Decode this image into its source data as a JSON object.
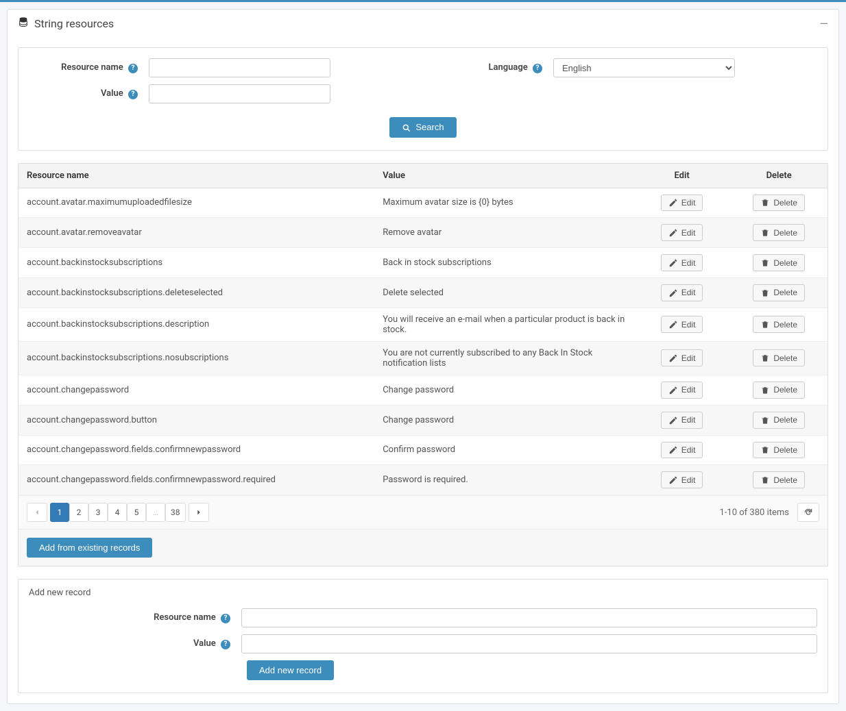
{
  "header": {
    "title": "String resources"
  },
  "search": {
    "resource_name_label": "Resource name",
    "value_label": "Value",
    "language_label": "Language",
    "language_selected": "English",
    "search_button": "Search"
  },
  "table": {
    "columns": {
      "resource_name": "Resource name",
      "value": "Value",
      "edit": "Edit",
      "delete": "Delete"
    },
    "edit_label": "Edit",
    "delete_label": "Delete",
    "rows": [
      {
        "name": "account.avatar.maximumuploadedfilesize",
        "value": "Maximum avatar size is {0} bytes"
      },
      {
        "name": "account.avatar.removeavatar",
        "value": "Remove avatar"
      },
      {
        "name": "account.backinstocksubscriptions",
        "value": "Back in stock subscriptions"
      },
      {
        "name": "account.backinstocksubscriptions.deleteselected",
        "value": "Delete selected"
      },
      {
        "name": "account.backinstocksubscriptions.description",
        "value": "You will receive an e-mail when a particular product is back in stock."
      },
      {
        "name": "account.backinstocksubscriptions.nosubscriptions",
        "value": "You are not currently subscribed to any Back In Stock notification lists"
      },
      {
        "name": "account.changepassword",
        "value": "Change password"
      },
      {
        "name": "account.changepassword.button",
        "value": "Change password"
      },
      {
        "name": "account.changepassword.fields.confirmnewpassword",
        "value": "Confirm password"
      },
      {
        "name": "account.changepassword.fields.confirmnewpassword.required",
        "value": "Password is required."
      }
    ],
    "pagination": {
      "pages": [
        "1",
        "2",
        "3",
        "4",
        "5",
        "…",
        "38"
      ],
      "active": "1",
      "summary": "1-10 of 380 items"
    },
    "add_existing_button": "Add from existing records"
  },
  "add_new": {
    "heading": "Add new record",
    "resource_name_label": "Resource name",
    "value_label": "Value",
    "submit_button": "Add new record"
  }
}
